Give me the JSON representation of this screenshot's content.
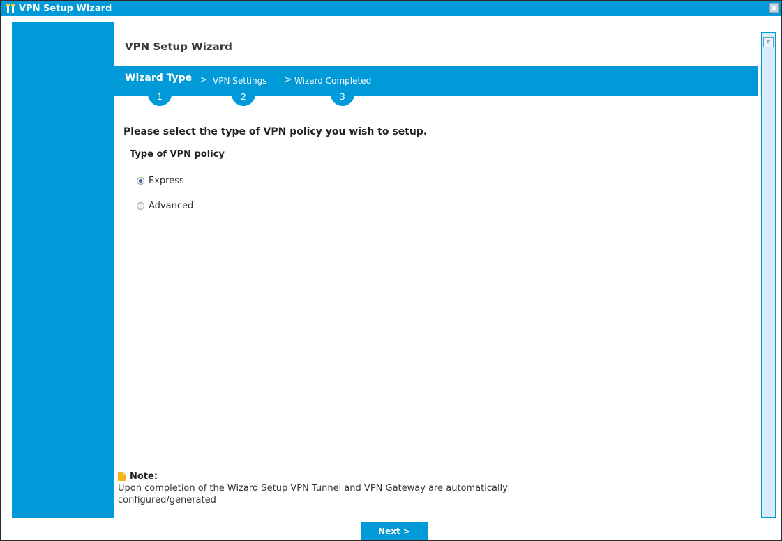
{
  "window": {
    "title": "VPN Setup Wizard"
  },
  "content": {
    "heading": "VPN Setup Wizard"
  },
  "steps": [
    {
      "label": "Wizard Type",
      "number": "1"
    },
    {
      "label": "VPN Settings",
      "number": "2"
    },
    {
      "label": "Wizard Completed",
      "number": "3"
    }
  ],
  "step_separator": ">",
  "prompt": "Please select the type of VPN policy you wish to setup.",
  "policy": {
    "label": "Type of VPN policy",
    "options": [
      {
        "label": "Express",
        "selected": true
      },
      {
        "label": "Advanced",
        "selected": false
      }
    ]
  },
  "note": {
    "title": "Note:",
    "line1": "Upon completion of the Wizard Setup VPN Tunnel and VPN Gateway are automatically",
    "line2": "configured/generated"
  },
  "collapse_glyph": "«",
  "next_label": "Next >",
  "colors": {
    "accent": "#009ad8",
    "note_icon": "#f6b51e"
  },
  "icons": {
    "title": "wizard-tools-icon",
    "close": "close-icon",
    "collapse": "double-chevron-left-icon",
    "note": "note-icon"
  }
}
